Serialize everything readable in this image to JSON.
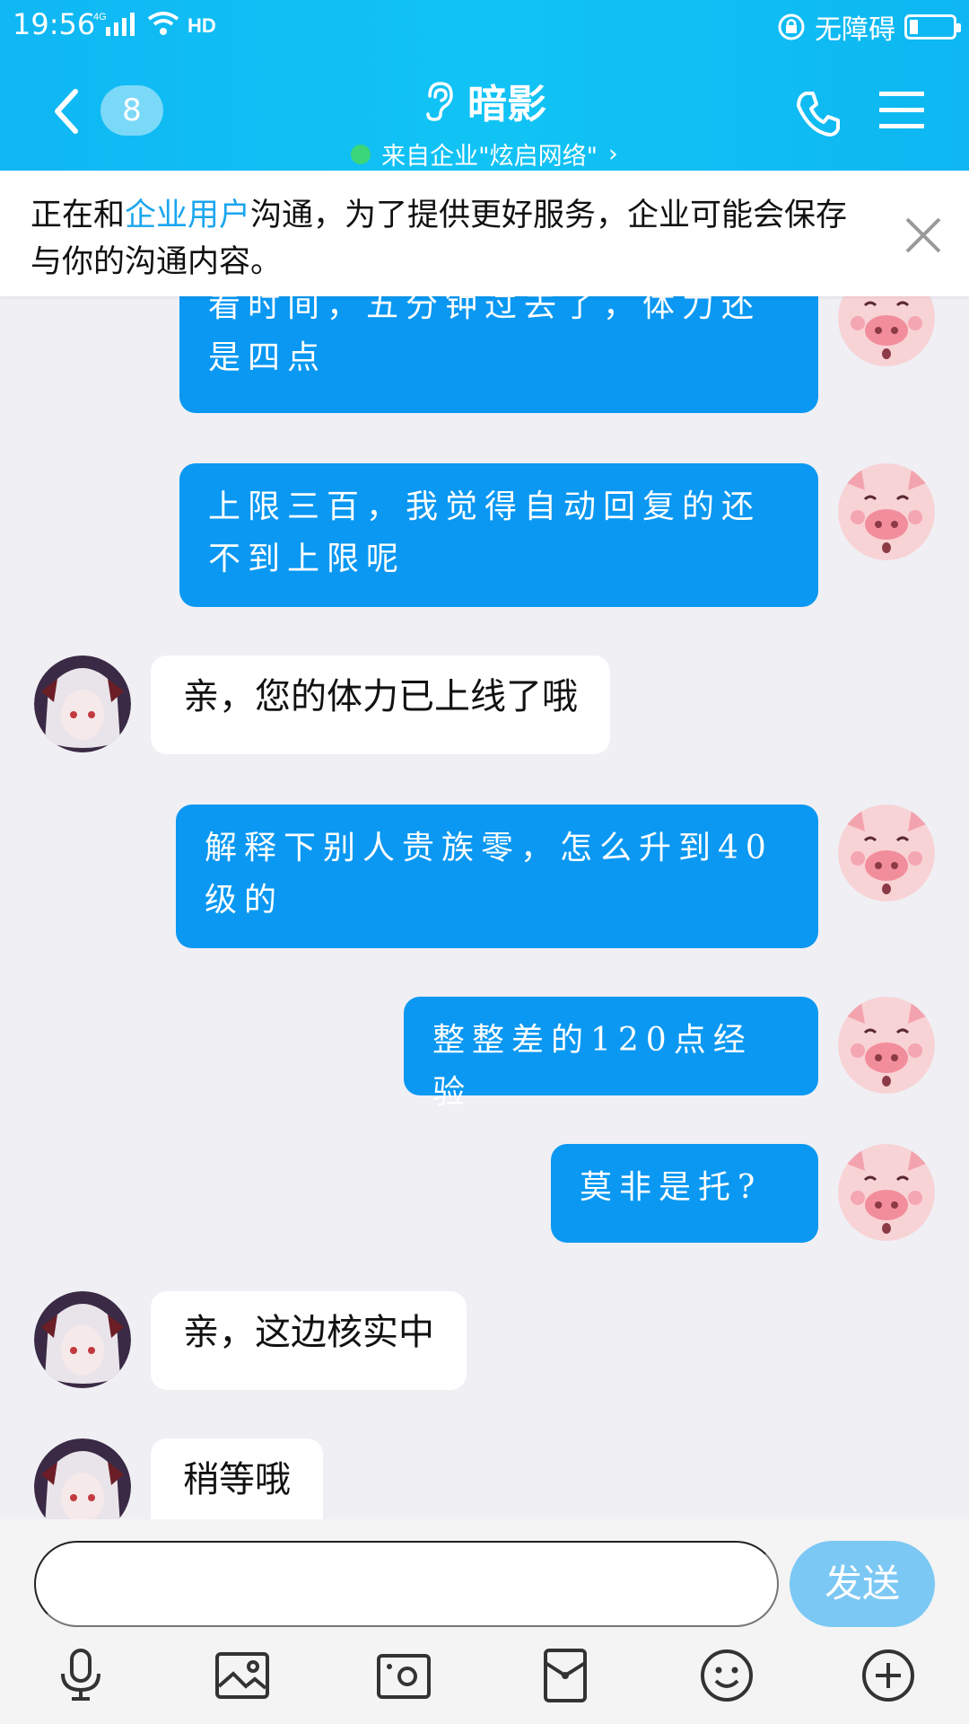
{
  "status": {
    "time": "19:56",
    "network": "4G",
    "hd": "HD",
    "accessibility": "无障碍",
    "battery_level": 0.18
  },
  "header": {
    "unread_count": "8",
    "title": "暗影",
    "subtitle": "来自企业\"炫启网络\"",
    "subtitle_arrow": "›",
    "title_icon": "ear-icon",
    "left_icon": "back-arrow-icon",
    "right_icons": [
      "phone-icon",
      "menu-icon"
    ]
  },
  "notice": {
    "before_link": "正在和",
    "link": "企业用户",
    "after_link": "沟通，为了提供更好服务，企业可能会保存与你的沟通内容。",
    "close_icon": "close-icon"
  },
  "messages": [
    {
      "direction": "out",
      "text": "看时间，五分钟过去了，体力还是四点"
    },
    {
      "direction": "out",
      "text": "上限三百，我觉得自动回复的还不到上限呢"
    },
    {
      "direction": "in",
      "text": "亲，您的体力已上线了哦"
    },
    {
      "direction": "out",
      "text": "解释下别人贵族零，怎么升到40级的"
    },
    {
      "direction": "out",
      "text": "整整差的120点经验"
    },
    {
      "direction": "out",
      "text": "莫非是托?"
    },
    {
      "direction": "in",
      "text": "亲，这边核实中"
    },
    {
      "direction": "in",
      "text": "稍等哦"
    }
  ],
  "input": {
    "placeholder": "",
    "send_label": "发送",
    "toolbar": [
      "microphone-icon",
      "image-icon",
      "camera-icon",
      "red-packet-icon",
      "emoji-icon",
      "plus-icon"
    ]
  },
  "colors": {
    "header_bg": "#11c3f5",
    "outgoing_bubble": "#0a98f2",
    "incoming_bubble": "#ffffff",
    "link": "#1aa6ee",
    "send_button": "#7cc8f4",
    "chat_bg": "#efeff4"
  }
}
